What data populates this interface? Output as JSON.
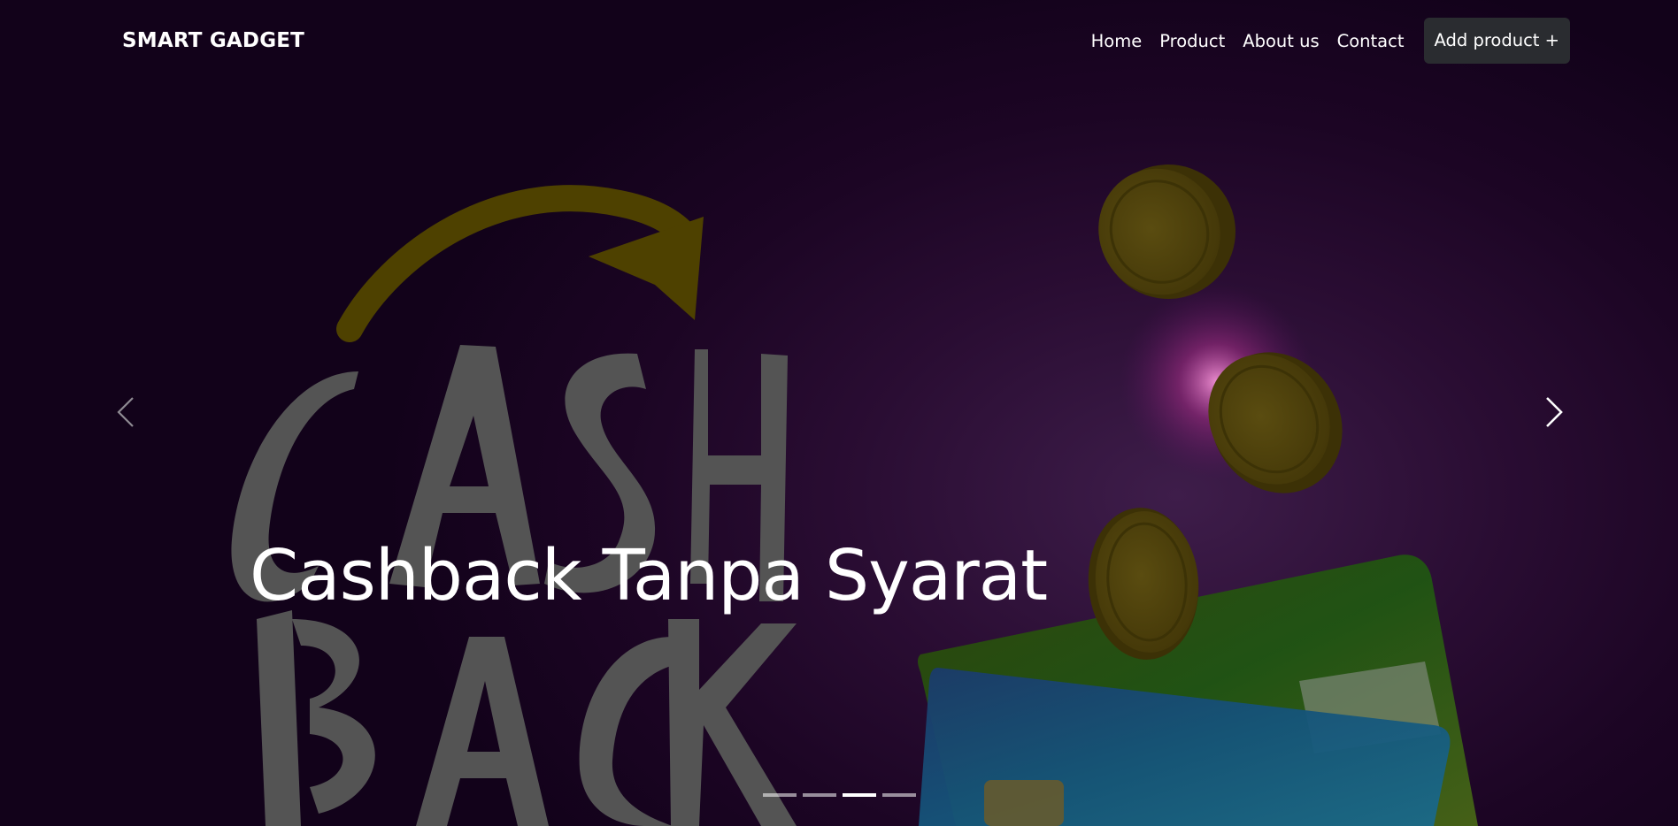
{
  "navbar": {
    "brand": "SMART GADGET",
    "links": [
      {
        "label": "Home"
      },
      {
        "label": "Product"
      },
      {
        "label": "About us"
      },
      {
        "label": "Contact"
      }
    ],
    "add_button": "Add product +"
  },
  "carousel": {
    "caption": "Cashback Tanpa Syarat",
    "background_art": {
      "lettering": [
        "CASH",
        "BACK"
      ],
      "objects": [
        "curved-arrow",
        "gold-coins",
        "bank-cards"
      ]
    },
    "prev_icon": "chevron-left-icon",
    "next_icon": "chevron-right-icon",
    "slide_count": 4,
    "active_index": 2
  },
  "colors": {
    "background": "#1a0422",
    "accent_purple": "#3e1d4a",
    "button_bg": "#2a2c30",
    "text": "#ffffff"
  }
}
